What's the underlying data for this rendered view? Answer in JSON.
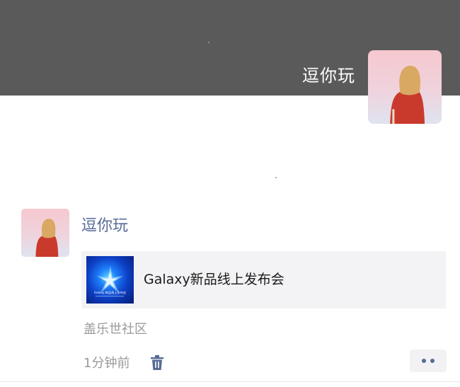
{
  "cover": {
    "user_name": "逗你玩",
    "background_color": "#5a5a5a"
  },
  "post": {
    "user_name": "逗你玩",
    "link": {
      "title": "Galaxy新品线上发布会",
      "thumbnail_text": "Galaxy 新品线上发布会"
    },
    "source": "盖乐世社区",
    "time": "1分钟前",
    "delete_icon": "trash-icon",
    "more_icon": "more-dots-icon"
  },
  "colors": {
    "name_link": "#576b95",
    "secondary_text": "#9a9a9a",
    "card_background": "#f3f3f5"
  }
}
